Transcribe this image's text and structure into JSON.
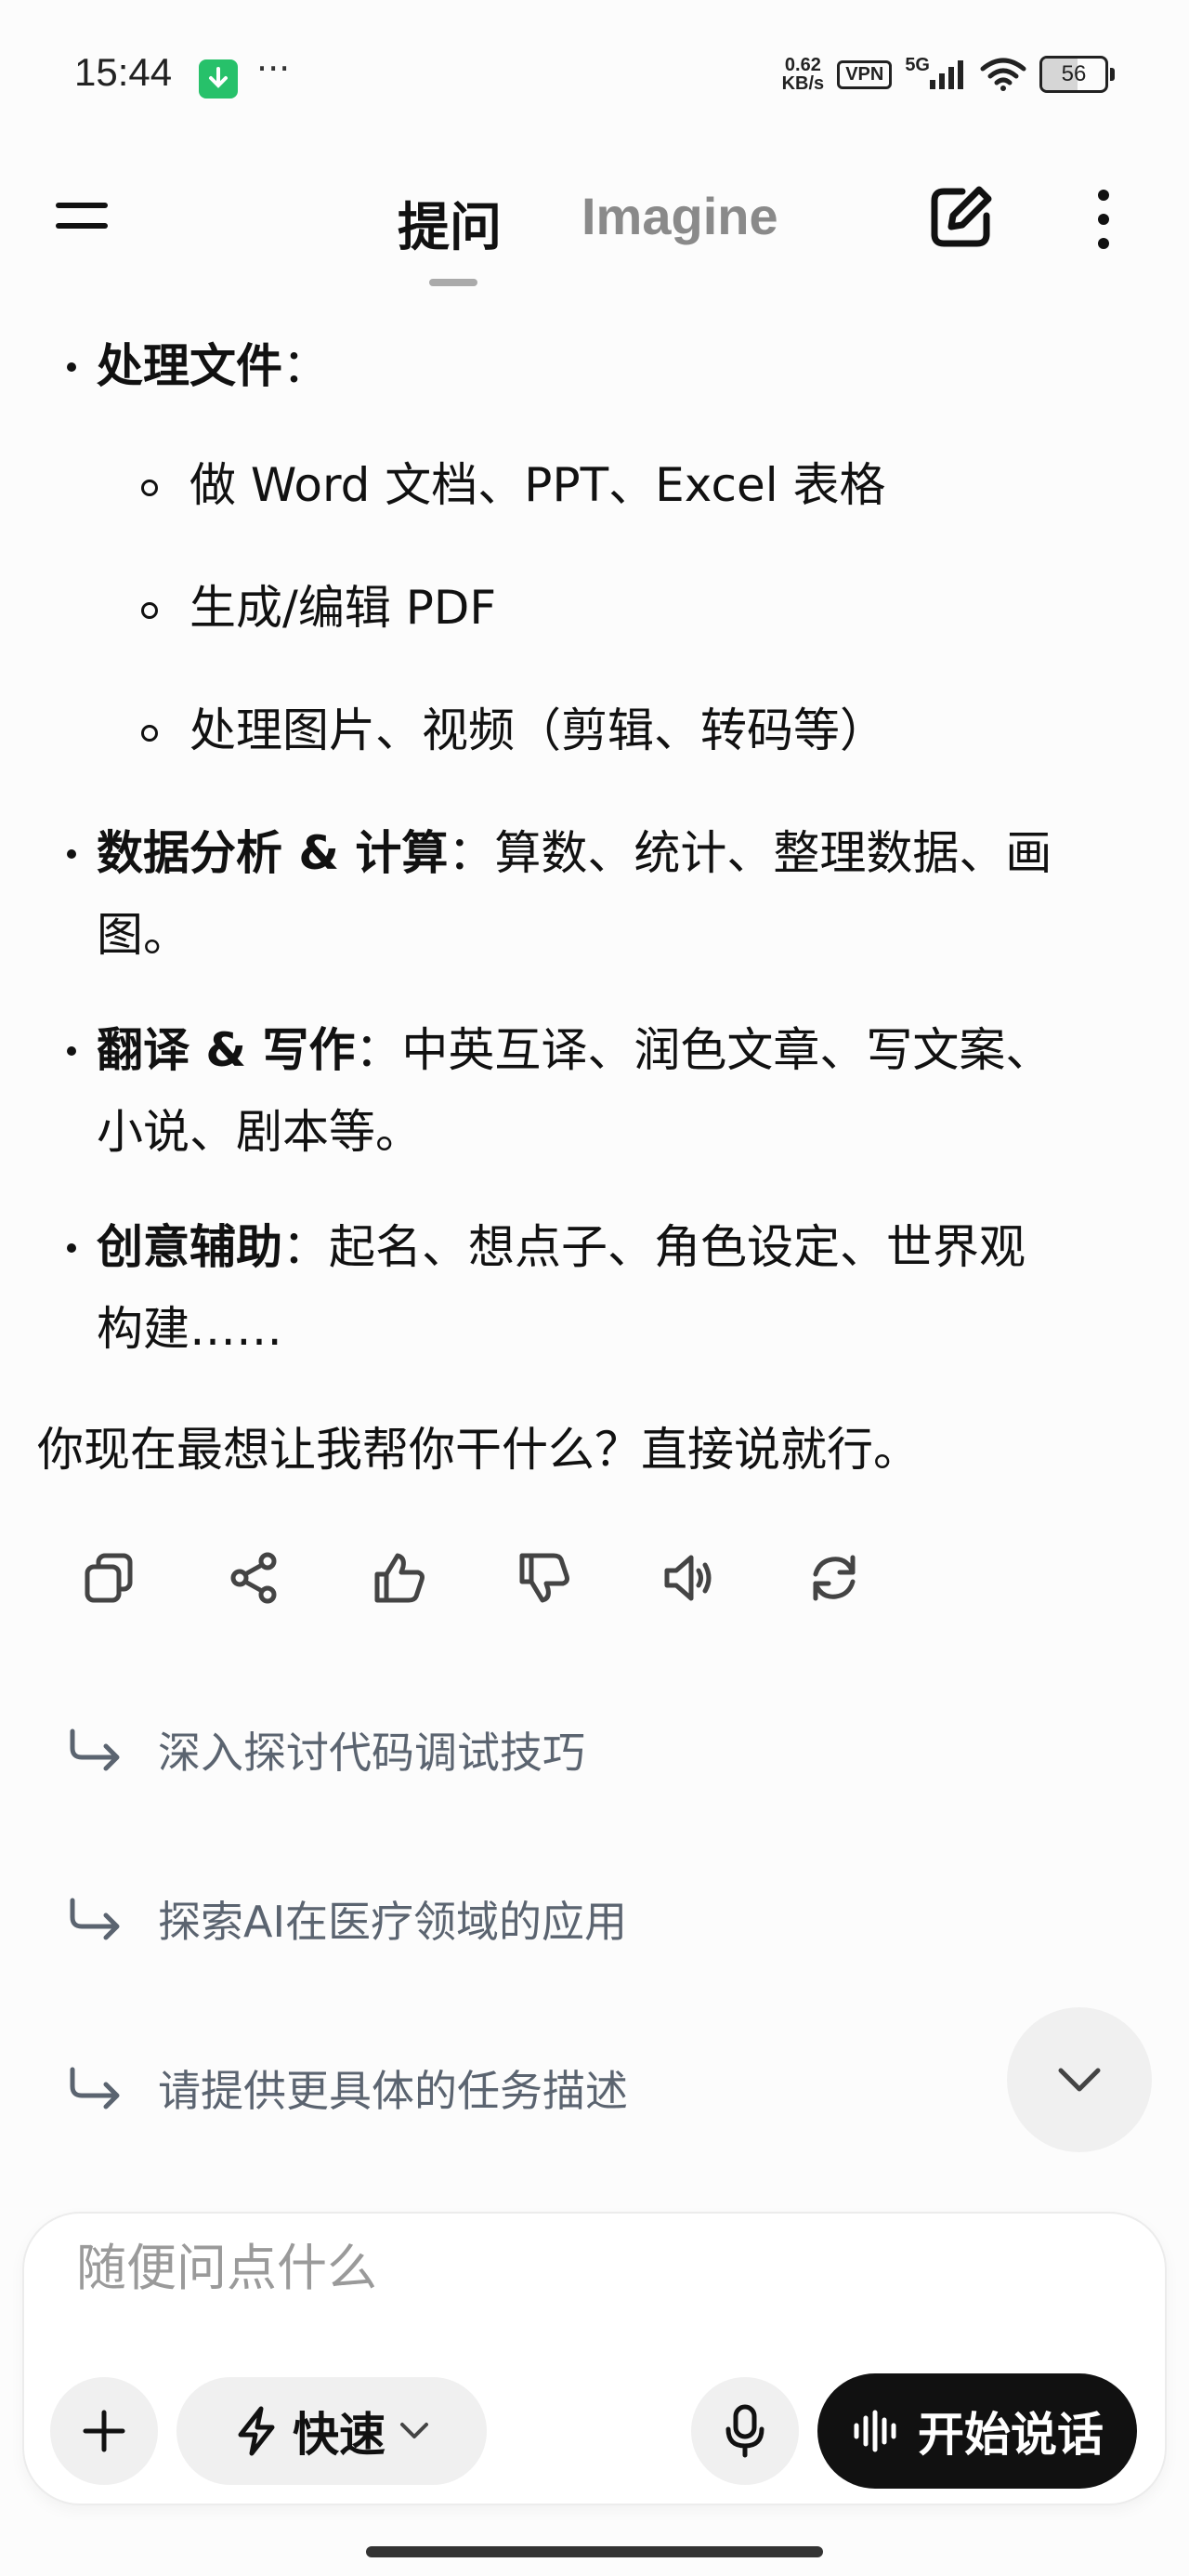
{
  "status": {
    "time": "15:44",
    "speed_top": "0.62",
    "speed_unit": "KB/s",
    "vpn": "VPN",
    "network": "5G",
    "battery": "56",
    "battery_level": 0.56
  },
  "header": {
    "tab_ask": "提问",
    "tab_imagine": "Imagine"
  },
  "content": {
    "file_title": "处理文件",
    "file_colon": "：",
    "file_sub": [
      "做 Word 文档、PPT、Excel 表格",
      "生成/编辑 PDF",
      "处理图片、视频（剪辑、转码等）"
    ],
    "data_title": "数据分析 & 计算",
    "data_rest_1": "：算数、统计、整理数据、画",
    "data_rest_2": "图。",
    "trans_title": "翻译 & 写作",
    "trans_rest_1": "：中英互译、润色文章、写文案、",
    "trans_rest_2": "小说、剧本等。",
    "creative_title": "创意辅助",
    "creative_rest_1": "：起名、想点子、角色设定、世界观",
    "creative_rest_2": "构建……",
    "closing": "你现在最想让我帮你干什么？直接说就行。"
  },
  "suggestions": [
    "深入探讨代码调试技巧",
    "探索AI在医疗领域的应用",
    "请提供更具体的任务描述"
  ],
  "composer": {
    "placeholder": "随便问点什么",
    "speed_label": "快速",
    "talk_label": "开始说话"
  }
}
